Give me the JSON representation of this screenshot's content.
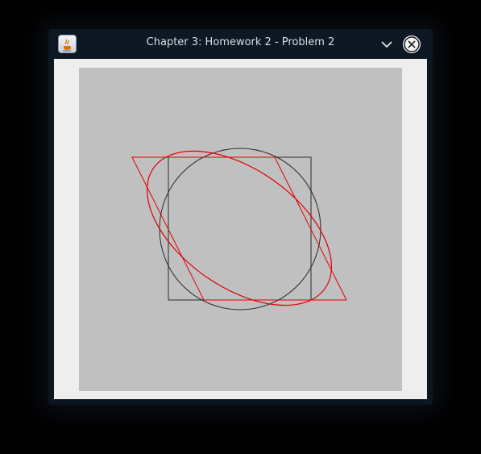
{
  "window": {
    "title": "Chapter 3: Homework 2 - Problem 2",
    "icon": "java-coffee-cup-icon",
    "controls": [
      "minimize-chevron-icon",
      "close-icon"
    ]
  },
  "colors": {
    "canvas_background": "#c0c0c0",
    "original_shapes": "#2a2a2a",
    "transformed_shapes": "#e00000"
  }
}
